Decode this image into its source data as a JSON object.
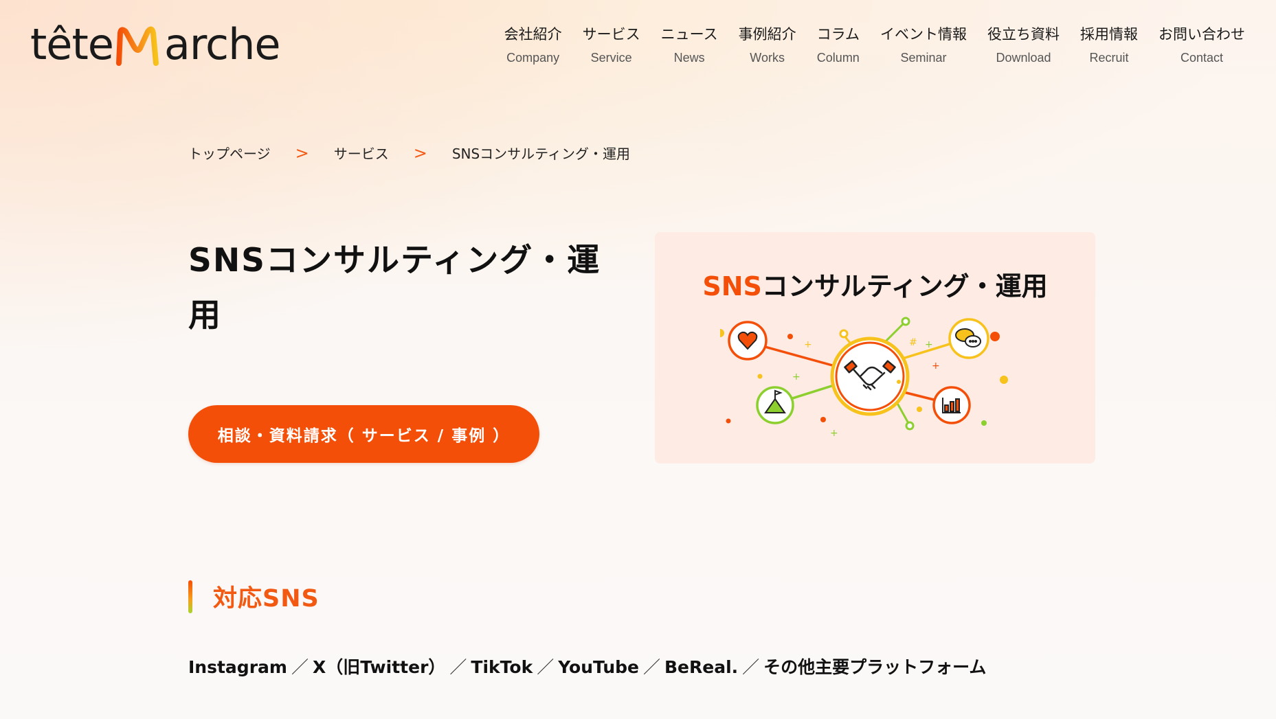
{
  "brand": {
    "logo_text_left": "tête",
    "logo_text_right": "arche"
  },
  "nav": [
    {
      "ja": "会社紹介",
      "en": "Company"
    },
    {
      "ja": "サービス",
      "en": "Service"
    },
    {
      "ja": "ニュース",
      "en": "News"
    },
    {
      "ja": "事例紹介",
      "en": "Works"
    },
    {
      "ja": "コラム",
      "en": "Column"
    },
    {
      "ja": "イベント情報",
      "en": "Seminar"
    },
    {
      "ja": "役立ち資料",
      "en": "Download"
    },
    {
      "ja": "採用情報",
      "en": "Recruit"
    },
    {
      "ja": "お問い合わせ",
      "en": "Contact"
    }
  ],
  "breadcrumb": {
    "items": [
      "トップページ",
      "サービス",
      "SNSコンサルティング・運用"
    ],
    "separator": ">"
  },
  "hero": {
    "title": "SNSコンサルティング・運用",
    "cta_label": "相談・資料請求（ サービス / 事例 ）",
    "card_title_accent": "SNS",
    "card_title_rest": "コンサルティング・運用"
  },
  "section": {
    "title": "対応SNS",
    "platforms": [
      "Instagram",
      "X（旧Twitter）",
      "TikTok",
      "YouTube",
      "BeReal.",
      "その他主要プラットフォーム"
    ],
    "separator": "／"
  },
  "colors": {
    "accent": "#f44f08",
    "yellow": "#f7c21b",
    "green": "#8ccf2e",
    "card_bg": "#fdebe4"
  },
  "icons": [
    "heart-icon",
    "handshake-icon",
    "chat-bubbles-icon",
    "mountain-flag-icon",
    "bar-chart-icon"
  ]
}
